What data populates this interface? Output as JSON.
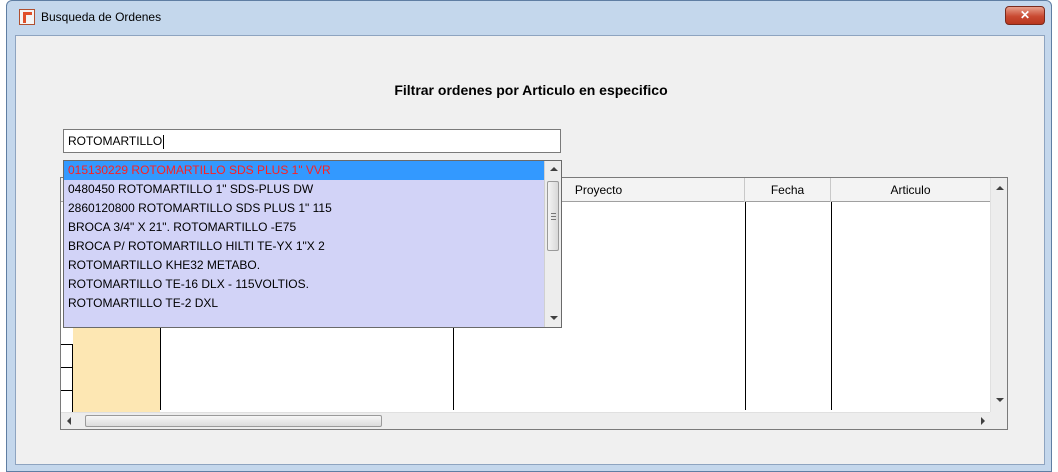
{
  "window": {
    "title": "Busqueda de Ordenes",
    "close_label": "✕"
  },
  "heading": "Filtrar ordenes por Articulo en especifico",
  "search": {
    "value": "ROTOMARTILLO"
  },
  "suggestions": [
    "015130229 ROTOMARTILLO SDS PLUS 1\" VVR",
    "0480450 ROTOMARTILLO 1\" SDS-PLUS DW",
    "2860120800 ROTOMARTILLO SDS PLUS 1\" 115",
    "BROCA 3/4\" X 21\". ROTOMARTILLO -E75",
    "BROCA P/ ROTOMARTILLO HILTI TE-YX 1\"X 2",
    "ROTOMARTILLO KHE32 METABO.",
    "ROTOMARTILLO TE-16 DLX - 115VOLTIOS.",
    "ROTOMARTILLO TE-2 DXL"
  ],
  "grid": {
    "columns": [
      "Proyecto",
      "Fecha",
      "Articulo"
    ]
  },
  "colors": {
    "selected_bg": "#3399ff",
    "selected_text": "#ff2020",
    "dropdown_bg": "#d2d3f7",
    "highlight_col": "#fde7b3"
  }
}
